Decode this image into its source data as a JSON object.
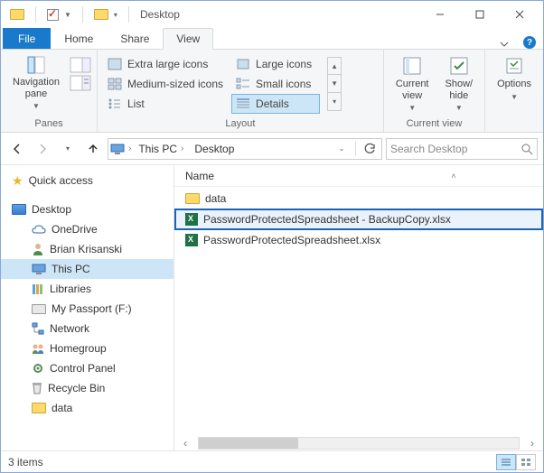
{
  "titlebar": {
    "title": "Desktop"
  },
  "tabs": {
    "file": "File",
    "home": "Home",
    "share": "Share",
    "view": "View",
    "active": "View"
  },
  "ribbon": {
    "panes": {
      "label": "Panes",
      "navigation": "Navigation\npane"
    },
    "layout": {
      "label": "Layout",
      "items": {
        "extra_large": "Extra large icons",
        "large": "Large icons",
        "medium": "Medium-sized icons",
        "small": "Small icons",
        "list": "List",
        "details": "Details"
      },
      "selected": "details"
    },
    "currentview": {
      "label": "Current view",
      "current": "Current\nview",
      "showhide": "Show/\nhide"
    },
    "options": "Options"
  },
  "nav": {
    "breadcrumb": [
      "This PC",
      "Desktop"
    ],
    "search_placeholder": "Search Desktop"
  },
  "tree": {
    "quick_access": "Quick access",
    "desktop": "Desktop",
    "items": [
      "OneDrive",
      "Brian Krisanski",
      "This PC",
      "Libraries",
      "My Passport (F:)",
      "Network",
      "Homegroup",
      "Control Panel",
      "Recycle Bin",
      "data"
    ],
    "selected": "This PC"
  },
  "columns": {
    "name": "Name"
  },
  "files": [
    {
      "name": "data",
      "type": "folder"
    },
    {
      "name": "PasswordProtectedSpreadsheet - BackupCopy.xlsx",
      "type": "excel",
      "highlighted": true
    },
    {
      "name": "PasswordProtectedSpreadsheet.xlsx",
      "type": "excel"
    }
  ],
  "status": {
    "count": "3 items"
  }
}
